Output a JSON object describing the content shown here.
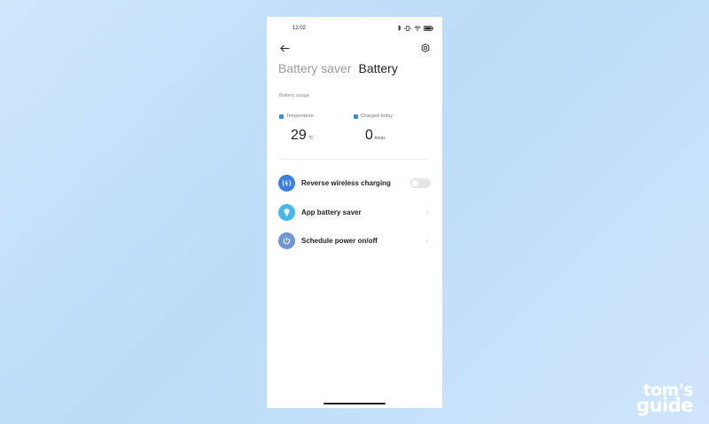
{
  "status_bar": {
    "time": "12:02",
    "icons": [
      "bluetooth-icon",
      "vibrate-icon",
      "wifi-icon",
      "battery-icon"
    ]
  },
  "header": {
    "back_icon": "arrow-left-icon",
    "settings_icon": "gear-icon",
    "tabs": [
      {
        "label": "Battery saver",
        "active": false
      },
      {
        "label": "Battery",
        "active": true
      }
    ]
  },
  "battery_usage": {
    "section_label": "Battery usage",
    "temperature": {
      "label": "Temperature",
      "value": "29",
      "unit": "°C"
    },
    "charged_today": {
      "label": "Charged today",
      "value": "0",
      "unit": "times"
    }
  },
  "settings_list": [
    {
      "label": "Reverse wireless charging",
      "icon": "wireless-charging-icon",
      "control": "toggle",
      "toggle_on": false,
      "icon_color": "#3d7fe0"
    },
    {
      "label": "App battery saver",
      "icon": "lightbulb-icon",
      "control": "chevron",
      "icon_color": "#45b7ee"
    },
    {
      "label": "Schedule power on/off",
      "icon": "power-icon",
      "control": "chevron",
      "icon_color": "#6f97d8"
    }
  ],
  "watermark": {
    "line1": "tom's",
    "line2": "guide"
  },
  "colors": {
    "accent": "#2f8fe8",
    "background": "#c7e0f8"
  }
}
